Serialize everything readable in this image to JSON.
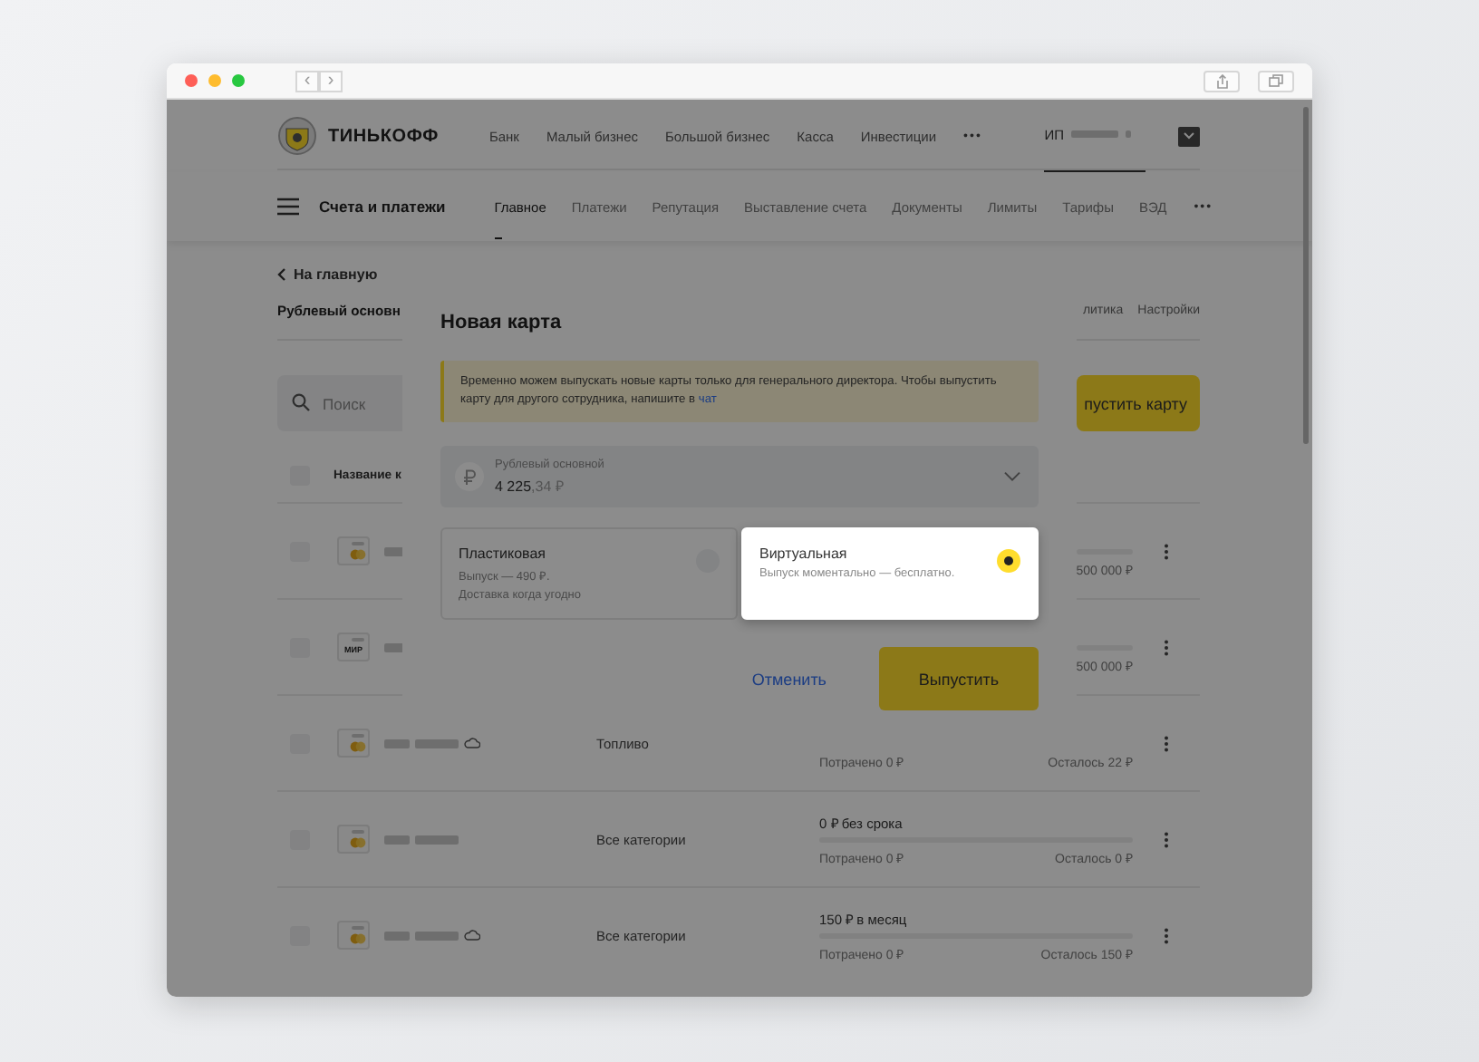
{
  "browser": {
    "back_label": "‹",
    "forward_label": "›"
  },
  "header": {
    "logo": "ТИНЬКОФФ",
    "nav": [
      "Банк",
      "Малый бизнес",
      "Большой бизнес",
      "Касса",
      "Инвестиции"
    ],
    "more": "•••",
    "account": "ИП"
  },
  "subheader": {
    "title": "Счета и платежи",
    "tabs": [
      {
        "label": "Главное",
        "selected": true
      },
      {
        "label": "Платежи",
        "selected": false
      },
      {
        "label": "Репутация",
        "selected": false
      },
      {
        "label": "Выставление счета",
        "selected": false
      },
      {
        "label": "Документы",
        "selected": false
      },
      {
        "label": "Лимиты",
        "selected": false
      },
      {
        "label": "Тарифы",
        "selected": false
      },
      {
        "label": "ВЭД",
        "selected": false
      }
    ],
    "more": "•••"
  },
  "back_link": "На главную",
  "account_title": "Рублевый основн",
  "account_tabs": [
    "литика",
    "Настройки"
  ],
  "search": {
    "placeholder": "Поиск"
  },
  "issue_button": "пустить карту",
  "table": {
    "header_checked": false,
    "name_column": "Название к",
    "rows": [
      {
        "kind": "mastercard",
        "checked": false,
        "virtual": false,
        "level": 0,
        "remaining": "500 000 ₽"
      },
      {
        "kind": "mir",
        "brand_label": "МИР",
        "checked": false,
        "virtual": false,
        "level": 0,
        "remaining": "500 000 ₽"
      },
      {
        "kind": "mastercard",
        "checked": false,
        "virtual": true,
        "category": "Топливо",
        "spent": "Потрачено 0 ₽",
        "remaining": "Осталось 22 ₽"
      },
      {
        "kind": "mastercard",
        "checked": false,
        "virtual": false,
        "category": "Все категории",
        "limit": "0 ₽ без срока",
        "level": 0,
        "spent": "Потрачено 0 ₽",
        "remaining": "Осталось 0 ₽"
      },
      {
        "kind": "mastercard",
        "checked": false,
        "virtual": true,
        "category": "Все категории",
        "limit": "150 ₽ в месяц",
        "level": 0,
        "spent": "Потрачено 0 ₽",
        "remaining": "Осталось 150 ₽"
      }
    ]
  },
  "modal": {
    "title": "Новая карта",
    "notice": "Временно можем выпускать новые карты только для генерального директора. Чтобы выпустить карту для другого сотрудника, напишите в",
    "notice_link": "чат",
    "account": {
      "name": "Рублевый основной",
      "amount_whole": "4 225",
      "amount_fraction": ",34 ₽"
    },
    "options": [
      {
        "title": "Пластиковая",
        "lines": [
          "Выпуск — 490 ₽.",
          "Доставка когда угодно"
        ],
        "selected": false
      },
      {
        "title": "Виртуальная",
        "lines": [
          "Выпуск моментально — бесплатно."
        ],
        "selected": true
      }
    ],
    "cancel": "Отменить",
    "submit": "Выпустить"
  }
}
